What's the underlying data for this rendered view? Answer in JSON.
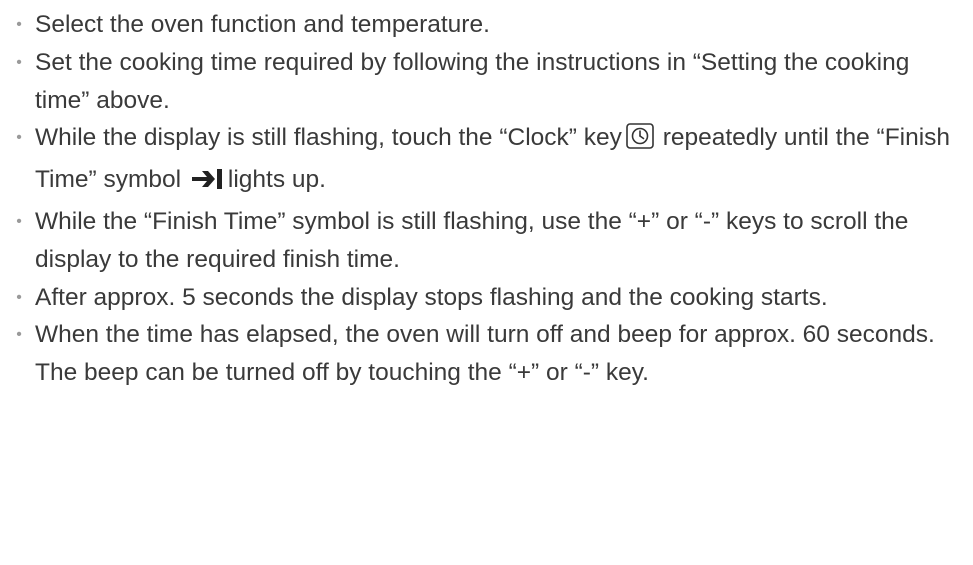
{
  "steps": [
    {
      "text": "Select the oven function and temperature."
    },
    {
      "text": "Set the cooking time required by following the instructions in “Setting the cooking time” above."
    },
    {
      "text_before": "While the display is still flashing, touch the “Clock” key",
      "icon1": "clock-icon",
      "text_middle": "repeatedly until the “Finish Time” symbol",
      "icon2": "finish-time-icon",
      "text_after": "lights up."
    },
    {
      "text": "While the “Finish Time” symbol is still flashing, use the “+” or “-” keys to scroll the display to the required finish time."
    },
    {
      "text": "After approx. 5 seconds the display stops flashing and the cooking starts."
    },
    {
      "text": "When the time has elapsed, the oven will turn off and beep for approx. 60 seconds.  The beep can be turned off by touching the “+” or “-” key."
    }
  ],
  "bullet_glyph": "•",
  "colors": {
    "text": "#3a3a3a",
    "bullet": "#9a9a9a",
    "icon": "#333333"
  }
}
